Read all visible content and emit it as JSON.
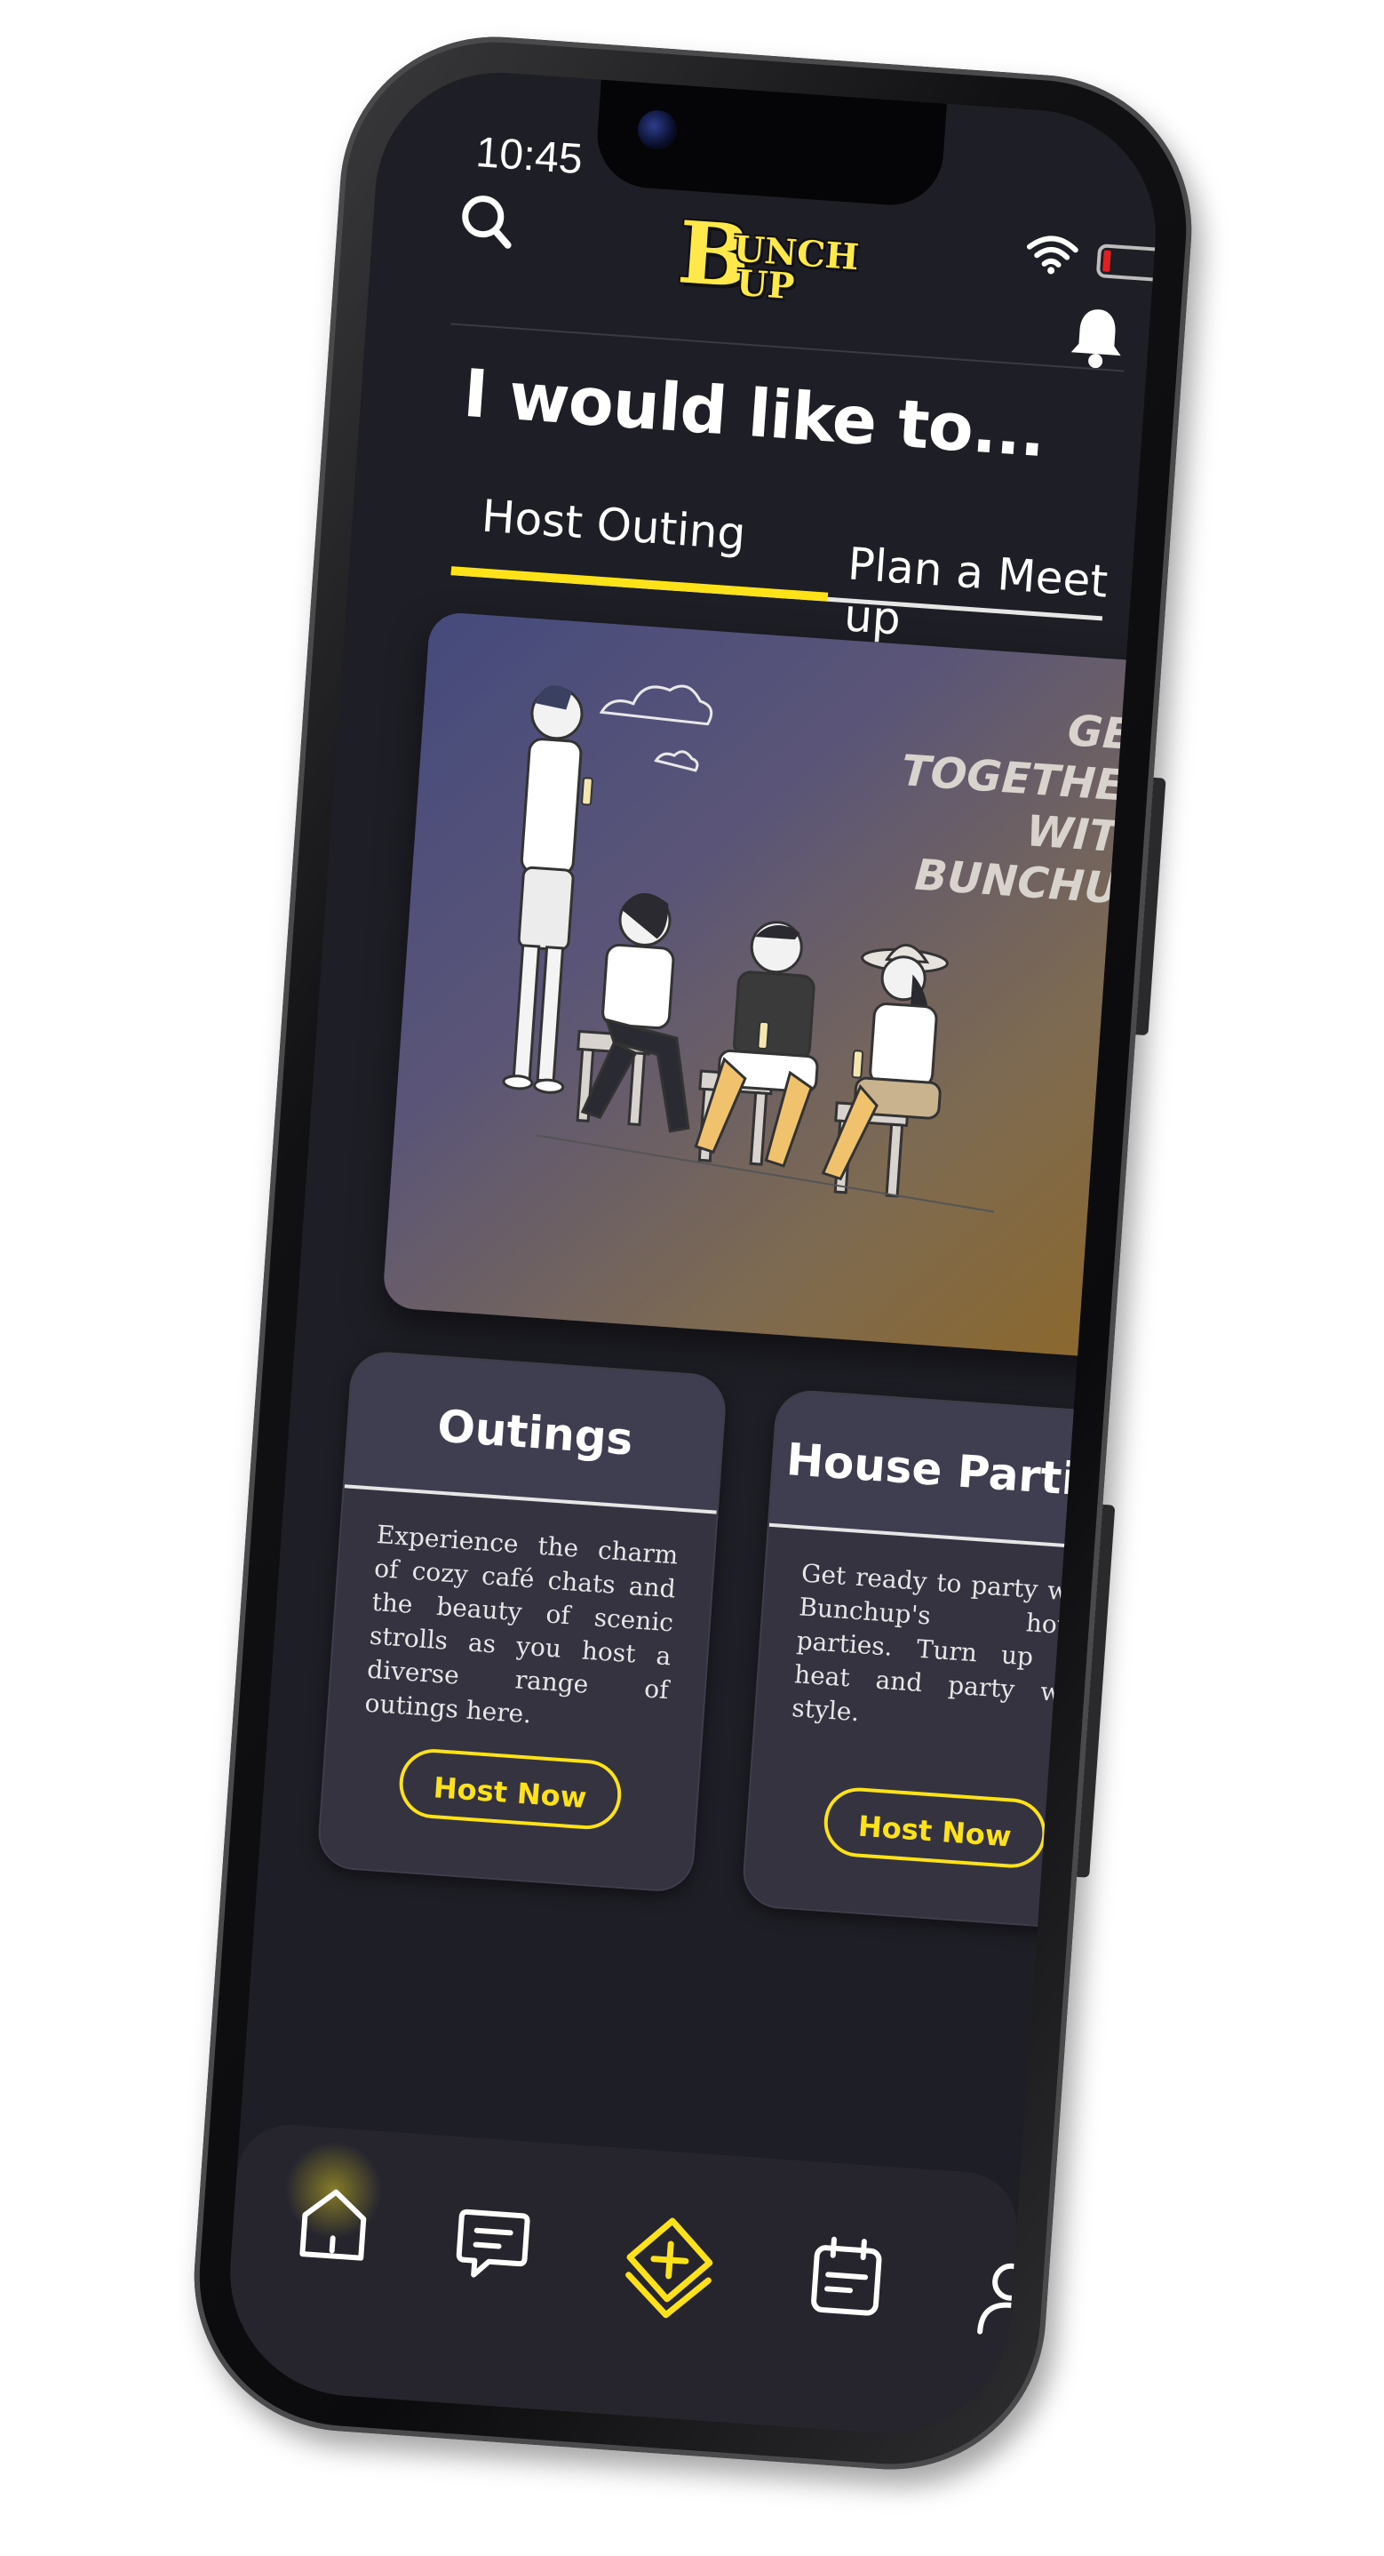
{
  "status_bar": {
    "time": "10:45",
    "icons": [
      "wifi-icon",
      "battery-icon"
    ]
  },
  "header": {
    "logo_letter": "B",
    "logo_top": "UNCH",
    "logo_bottom": "UP",
    "icons": [
      "search-icon",
      "bell-icon"
    ]
  },
  "page": {
    "title": "I would like to..."
  },
  "tabs": [
    {
      "label": "Host Outing",
      "active": true
    },
    {
      "label": "Plan a  Meet up",
      "active": false
    }
  ],
  "hero": {
    "title_line1": "GET TOGETHER",
    "title_line2": "WITH BUNCHUP"
  },
  "cards": [
    {
      "title": "Outings",
      "description": "Experience the charm of cozy café chats and the beauty of scenic strolls as you host a diverse range of outings here.",
      "button": "Host Now"
    },
    {
      "title": "House Parties",
      "description": "Get ready to party with Bunchup's house parties. Turn up the heat and party with style.",
      "button": "Host Now"
    }
  ],
  "bottom_nav": {
    "items": [
      "home-icon",
      "chat-icon",
      "host-plus-icon",
      "calendar-icon",
      "profile-icon"
    ],
    "active": "host-plus-icon"
  },
  "colors": {
    "accent": "#fde21a",
    "background": "#1e1e26",
    "card": "#34333f",
    "text": "#ffffff"
  }
}
